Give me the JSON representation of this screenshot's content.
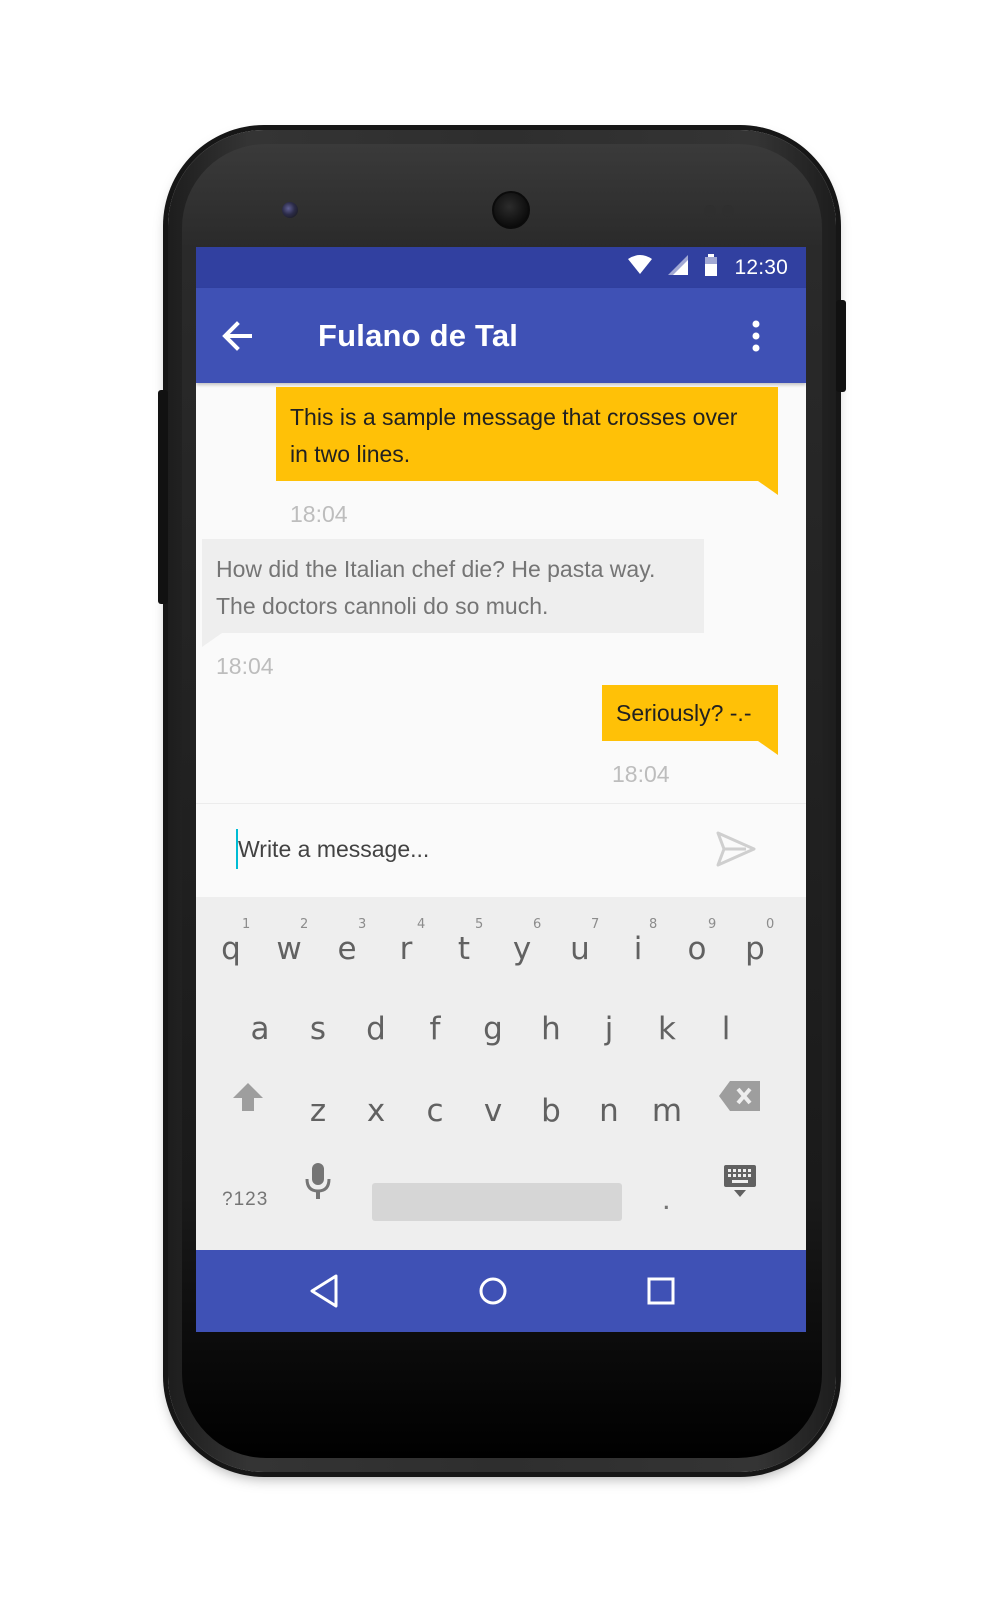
{
  "status_bar": {
    "time": "12:30",
    "icons": [
      "wifi-icon",
      "signal-icon",
      "battery-icon"
    ]
  },
  "app_bar": {
    "title": "Fulano de Tal",
    "back_icon": "arrow-left-icon",
    "menu_icon": "more-vert-icon"
  },
  "messages": [
    {
      "direction": "outgoing",
      "text_line1": "This is a sample message that crosses over",
      "text_line2": "in two lines.",
      "time": "18:04"
    },
    {
      "direction": "incoming",
      "text_line1": "How did the Italian chef die? He pasta way.",
      "text_line2": "The doctors cannoli do so much.",
      "time": "18:04"
    },
    {
      "direction": "outgoing",
      "text_line1": "Seriously? -.-",
      "time": "18:04"
    }
  ],
  "compose": {
    "placeholder": "Write a message...",
    "send_icon": "send-icon"
  },
  "keyboard": {
    "row1": [
      {
        "key": "q",
        "hint": "1"
      },
      {
        "key": "w",
        "hint": "2"
      },
      {
        "key": "e",
        "hint": "3"
      },
      {
        "key": "r",
        "hint": "4"
      },
      {
        "key": "t",
        "hint": "5"
      },
      {
        "key": "y",
        "hint": "6"
      },
      {
        "key": "u",
        "hint": "7"
      },
      {
        "key": "i",
        "hint": "8"
      },
      {
        "key": "o",
        "hint": "9"
      },
      {
        "key": "p",
        "hint": "0"
      }
    ],
    "row2": [
      "a",
      "s",
      "d",
      "f",
      "g",
      "h",
      "j",
      "k",
      "l"
    ],
    "row3": [
      "z",
      "x",
      "c",
      "v",
      "b",
      "n",
      "m"
    ],
    "symbols_label": "?123",
    "period_label": ".",
    "special_icons": [
      "shift-icon",
      "backspace-icon",
      "microphone-icon",
      "keyboard-hide-icon"
    ]
  },
  "nav_bar": {
    "icons": [
      "nav-back-icon",
      "nav-home-icon",
      "nav-recents-icon"
    ]
  },
  "colors": {
    "status_bar": "#3140a0",
    "primary": "#3f51b5",
    "accent": "#ffc107",
    "incoming_bubble": "#eeeeee",
    "cursor": "#00bcd4"
  }
}
